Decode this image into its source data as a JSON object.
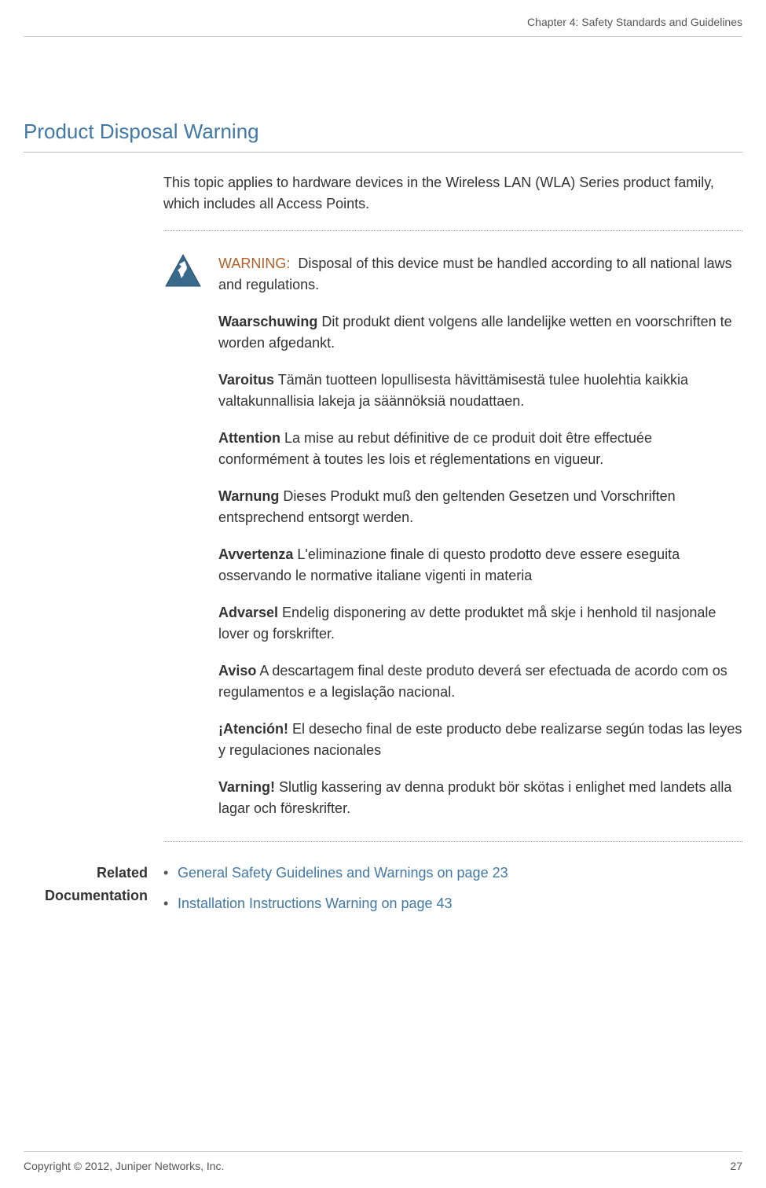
{
  "header": {
    "chapter": "Chapter 4: Safety Standards and Guidelines"
  },
  "heading": "Product Disposal Warning",
  "intro": "This topic applies to hardware devices in the Wireless LAN (WLA) Series product family, which includes all Access Points.",
  "warning": {
    "label": "WARNING:",
    "main_text": "Disposal of this device must be handled according to all national laws and regulations.",
    "translations": [
      {
        "label": "Waarschuwing",
        "text": " Dit produkt dient volgens alle landelijke wetten en voorschriften te worden afgedankt."
      },
      {
        "label": "Varoitus",
        "text": " Tämän tuotteen lopullisesta hävittämisestä tulee huolehtia kaikkia valtakunnallisia lakeja ja säännöksiä noudattaen."
      },
      {
        "label": "Attention",
        "text": " La mise au rebut définitive de ce produit doit être effectuée conformément à toutes les lois et réglementations en vigueur."
      },
      {
        "label": "Warnung",
        "text": " Dieses Produkt muß den geltenden Gesetzen und Vorschriften entsprechend entsorgt werden."
      },
      {
        "label": "Avvertenza",
        "text": " L'eliminazione finale di questo prodotto deve essere eseguita osservando le normative italiane vigenti in materia"
      },
      {
        "label": "Advarsel",
        "text": " Endelig disponering av dette produktet må skje i henhold til nasjonale lover og forskrifter."
      },
      {
        "label": "Aviso",
        "text": " A descartagem final deste produto deverá ser efectuada de acordo com os regulamentos e a legislação nacional."
      },
      {
        "label": "¡Atención!",
        "text": " El desecho final de este producto debe realizarse según todas las leyes y regulaciones nacionales"
      },
      {
        "label": "Varning!",
        "text": " Slutlig kassering av denna produkt bör skötas i enlighet med landets alla lagar och föreskrifter."
      }
    ]
  },
  "related": {
    "label": "Related Documentation",
    "links": [
      "General Safety Guidelines and Warnings on page 23",
      "Installation Instructions Warning on page 43"
    ]
  },
  "footer": {
    "copyright": "Copyright © 2012, Juniper Networks, Inc.",
    "page": "27"
  }
}
